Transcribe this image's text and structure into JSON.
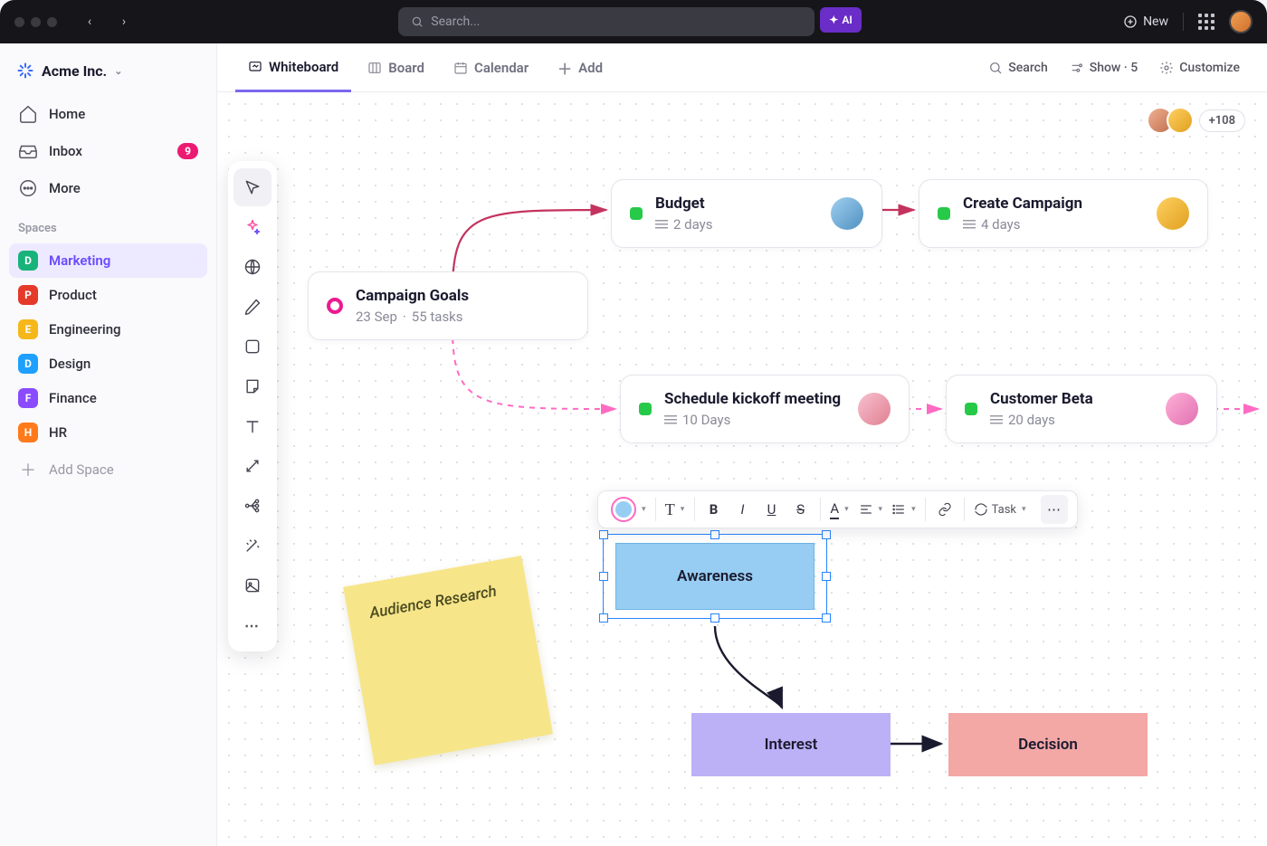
{
  "titlebar": {
    "search_placeholder": "Search...",
    "ai": "AI",
    "new": "New"
  },
  "workspace": {
    "name": "Acme Inc."
  },
  "nav": {
    "home": "Home",
    "inbox": "Inbox",
    "inbox_count": "9",
    "more": "More"
  },
  "spaces_title": "Spaces",
  "spaces": [
    {
      "letter": "D",
      "label": "Marketing",
      "color": "#18b37a",
      "active": true
    },
    {
      "letter": "P",
      "label": "Product",
      "color": "#e5392a",
      "active": false
    },
    {
      "letter": "E",
      "label": "Engineering",
      "color": "#f5b71a",
      "active": false
    },
    {
      "letter": "D",
      "label": "Design",
      "color": "#1ea0ff",
      "active": false
    },
    {
      "letter": "F",
      "label": "Finance",
      "color": "#8a4bff",
      "active": false
    },
    {
      "letter": "H",
      "label": "HR",
      "color": "#ff7a1a",
      "active": false
    }
  ],
  "add_space": "Add Space",
  "tabs": {
    "whiteboard": "Whiteboard",
    "board": "Board",
    "calendar": "Calendar",
    "add": "Add"
  },
  "viewbar": {
    "search": "Search",
    "show": "Show · 5",
    "customize": "Customize"
  },
  "presence": {
    "more": "+108"
  },
  "nodes": {
    "goals": {
      "title": "Campaign Goals",
      "date": "23 Sep",
      "tasks": "55 tasks"
    },
    "budget": {
      "title": "Budget",
      "meta": "2 days"
    },
    "campaign": {
      "title": "Create Campaign",
      "meta": "4 days"
    },
    "kickoff": {
      "title": "Schedule kickoff meeting",
      "meta": "10 Days"
    },
    "beta": {
      "title": "Customer Beta",
      "meta": "20 days"
    }
  },
  "sticky": {
    "text": "Audience Research"
  },
  "shapes": {
    "awareness": "Awareness",
    "interest": "Interest",
    "decision": "Decision"
  },
  "fmt": {
    "task": "Task"
  }
}
